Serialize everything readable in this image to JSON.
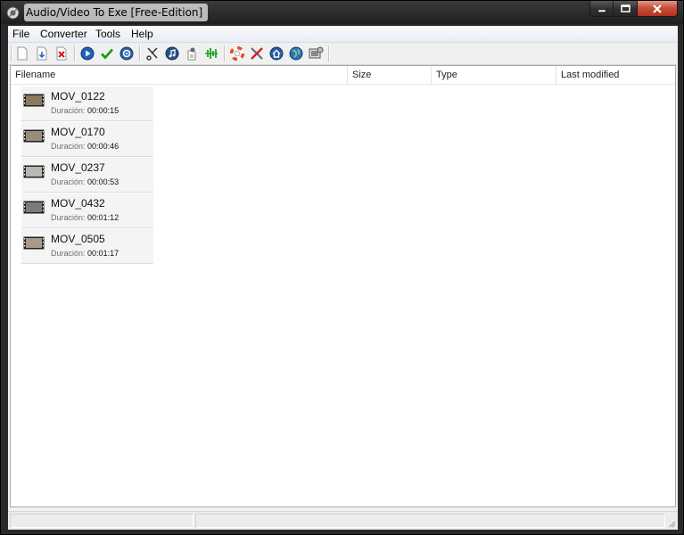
{
  "window": {
    "title": "Audio/Video To Exe [Free-Edition]",
    "caption": {
      "minimize": "–",
      "maximize": "□",
      "close": "✕"
    }
  },
  "menu": [
    "File",
    "Converter",
    "Tools",
    "Help"
  ],
  "toolbar": [
    {
      "name": "new-icon",
      "group": 1
    },
    {
      "name": "add-file-icon",
      "group": 1
    },
    {
      "name": "delete-icon",
      "group": 1
    },
    {
      "name": "play-icon",
      "group": 2
    },
    {
      "name": "check-icon",
      "group": 2
    },
    {
      "name": "settings-icon",
      "group": 2
    },
    {
      "name": "cut-icon",
      "group": 3
    },
    {
      "name": "music-icon",
      "group": 3
    },
    {
      "name": "extract-icon",
      "group": 3
    },
    {
      "name": "equalizer-icon",
      "group": 3
    },
    {
      "name": "help-lifebuoy-icon",
      "group": 4
    },
    {
      "name": "tools-icon",
      "group": 4
    },
    {
      "name": "home-icon",
      "group": 4
    },
    {
      "name": "globe-icon",
      "group": 4
    },
    {
      "name": "about-icon",
      "group": 4
    }
  ],
  "columns": [
    "Filename",
    "Size",
    "Type",
    "Last modified"
  ],
  "duration_label": "Duración:",
  "files": [
    {
      "name": "MOV_0122",
      "duration": "00:00:15"
    },
    {
      "name": "MOV_0170",
      "duration": "00:00:46"
    },
    {
      "name": "MOV_0237",
      "duration": "00:00:53"
    },
    {
      "name": "MOV_0432",
      "duration": "00:01:12"
    },
    {
      "name": "MOV_0505",
      "duration": "00:01:17"
    }
  ],
  "status": [
    "",
    ""
  ]
}
